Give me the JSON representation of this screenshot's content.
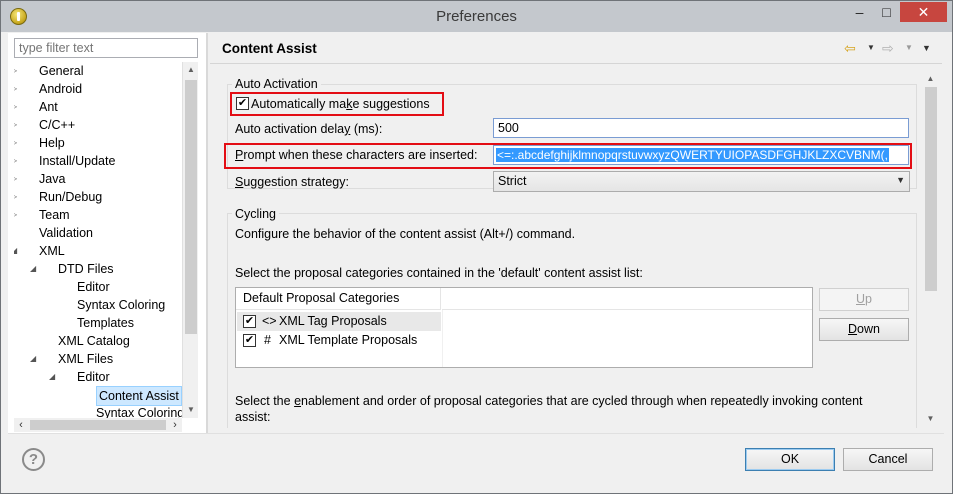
{
  "window": {
    "title": "Preferences"
  },
  "titlebar": {
    "minimize": "–",
    "maximize": "□",
    "close": "✕"
  },
  "filter": {
    "placeholder": "type filter text"
  },
  "tree": [
    {
      "label": "General",
      "depth": 0,
      "arrow": "▷"
    },
    {
      "label": "Android",
      "depth": 0,
      "arrow": "▷"
    },
    {
      "label": "Ant",
      "depth": 0,
      "arrow": "▷"
    },
    {
      "label": "C/C++",
      "depth": 0,
      "arrow": "▷"
    },
    {
      "label": "Help",
      "depth": 0,
      "arrow": "▷"
    },
    {
      "label": "Install/Update",
      "depth": 0,
      "arrow": "▷"
    },
    {
      "label": "Java",
      "depth": 0,
      "arrow": "▷"
    },
    {
      "label": "Run/Debug",
      "depth": 0,
      "arrow": "▷"
    },
    {
      "label": "Team",
      "depth": 0,
      "arrow": "▷"
    },
    {
      "label": "Validation",
      "depth": 0,
      "arrow": ""
    },
    {
      "label": "XML",
      "depth": 0,
      "arrow": "◢"
    },
    {
      "label": "DTD Files",
      "depth": 1,
      "arrow": "◢"
    },
    {
      "label": "Editor",
      "depth": 2,
      "arrow": ""
    },
    {
      "label": "Syntax Coloring",
      "depth": 2,
      "arrow": ""
    },
    {
      "label": "Templates",
      "depth": 2,
      "arrow": ""
    },
    {
      "label": "XML Catalog",
      "depth": 1,
      "arrow": ""
    },
    {
      "label": "XML Files",
      "depth": 1,
      "arrow": "◢"
    },
    {
      "label": "Editor",
      "depth": 2,
      "arrow": "◢"
    },
    {
      "label": "Content Assist",
      "depth": 3,
      "arrow": "",
      "selected": true
    },
    {
      "label": "Syntax Coloring",
      "depth": 3,
      "arrow": ""
    }
  ],
  "page": {
    "title": "Content Assist"
  },
  "nav": {
    "back": "⇦",
    "forward": "⇨",
    "dropdown": "▼",
    "menu": "▼"
  },
  "auto_activation": {
    "group_title": "Auto Activation",
    "make_suggestions_pre": "Automatically ma",
    "make_suggestions_key": "k",
    "make_suggestions_post": "e suggestions",
    "make_suggestions_checked": true,
    "delay_pre": "Auto activation dela",
    "delay_key": "y",
    "delay_post": " (ms):",
    "delay_value": "500",
    "prompt_key": "P",
    "prompt_post": "rompt when these characters are inserted:",
    "prompt_value": "<=:.abcdefghijklmnopqrstuvwxyzQWERTYUIOPASDFGHJKLZXCVBNM(,",
    "strategy_key": "S",
    "strategy_post": "uggestion strategy:",
    "strategy_value": "Strict"
  },
  "cycling": {
    "group_title": "Cycling",
    "description": "Configure the behavior of the content assist (Alt+/) command.",
    "default_list_label": "Select the proposal categories contained in the 'default' content assist list:",
    "table_header": "Default Proposal Categories",
    "rows": [
      {
        "icon": "<>",
        "label": "XML Tag Proposals",
        "checked": true
      },
      {
        "icon": "#",
        "label": "XML Template Proposals",
        "checked": true
      }
    ],
    "up_key": "U",
    "up_post": "p",
    "down_key": "D",
    "down_post": "own",
    "cycle_pre": "Select the ",
    "cycle_key": "e",
    "cycle_post": "nablement and order of proposal categories that are cycled through when repeatedly invoking content",
    "cycle_line2": "assist:"
  },
  "footer": {
    "help": "?",
    "ok": "OK",
    "cancel": "Cancel"
  }
}
